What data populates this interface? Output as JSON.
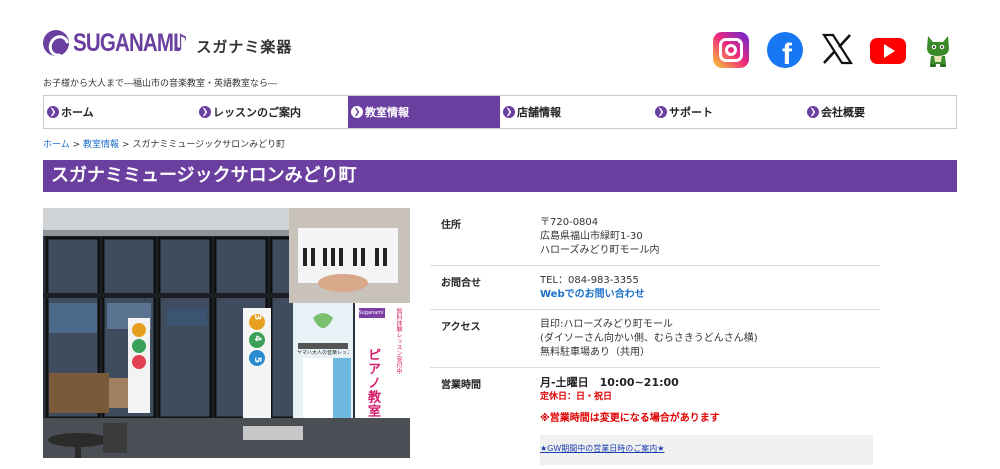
{
  "header": {
    "logo_word": "SUGANAMI",
    "logo_note": "♪",
    "logo_jp": "スガナミ楽器",
    "tagline": "お子様から大人まで―福山市の音楽教室・英語教室なら―",
    "social": [
      {
        "name": "instagram-icon"
      },
      {
        "name": "facebook-icon",
        "glyph": "f"
      },
      {
        "name": "x-icon"
      },
      {
        "name": "youtube-icon"
      },
      {
        "name": "mascot-icon"
      }
    ],
    "brand_color": "#6b3fa0"
  },
  "nav": {
    "items": [
      {
        "label": "ホーム",
        "active": false
      },
      {
        "label": "レッスンのご案内",
        "active": false
      },
      {
        "label": "教室情報",
        "active": true
      },
      {
        "label": "店舗情報",
        "active": false
      },
      {
        "label": "サポート",
        "active": false
      },
      {
        "label": "会社概要",
        "active": false
      }
    ],
    "arrow": "❯"
  },
  "breadcrumb": {
    "home": "ホーム",
    "sep": ">",
    "section": "教室情報",
    "current": "スガナミミュージックサロンみどり町"
  },
  "page": {
    "title": "スガナミミュージックサロンみどり町"
  },
  "photo": {
    "banner_right": "ピアノ教室",
    "banner_mid": "ヤマハ大人の音楽レッスン",
    "badge_left": "3 4 5",
    "sign_top": "Suganami",
    "sign_side": "無料体験レッスン受付中"
  },
  "info": {
    "address": {
      "label": "住所",
      "lines": [
        "〒720-0804",
        "広島県福山市緑町1-30",
        "ハローズみどり町モール内"
      ]
    },
    "contact": {
      "label": "お問合せ",
      "tel": "TEL：084-983-3355",
      "web": "Webでのお問い合わせ"
    },
    "access": {
      "label": "アクセス",
      "lines": [
        "目印:ハローズみどり町モール",
        "(ダイソーさん向かい側、むらさきうどんさん横)",
        "無料駐車場あり（共用）"
      ]
    },
    "hours": {
      "label": "営業時間",
      "main": "月-土曜日　10:00~21:00",
      "closed": "定休日：日・祝日",
      "note": "※営業時間は変更になる場合があります",
      "link": "★GW期間中の営業日時のご案内★"
    }
  }
}
